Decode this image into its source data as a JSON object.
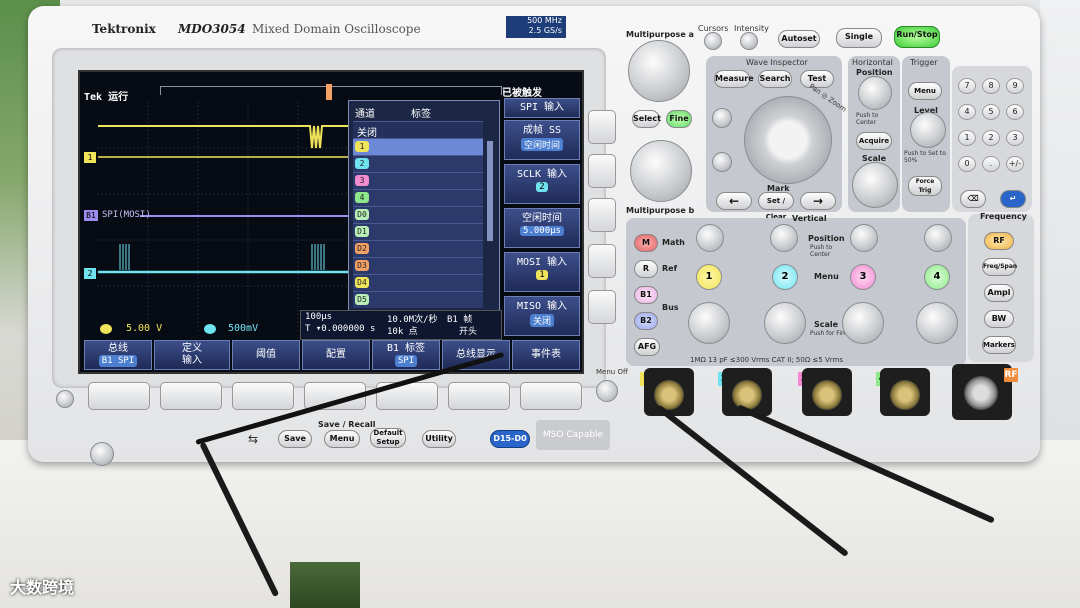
{
  "header": {
    "brand": "Tektronix",
    "model": "MDO3054",
    "subtitle": "Mixed Domain Oscilloscope",
    "spec_bw": "500 MHz",
    "spec_rate": "2.5 GS/s"
  },
  "screen": {
    "status_left": "Tek 运行",
    "status_right": "已被触发",
    "ch1_scale": "5.00 V",
    "ch2_scale": "500mV",
    "timebase": "100µs",
    "trigger_pos": "T ▾0.000000 s",
    "sample_rate": "10.0M次/秒",
    "record_length": "10k 点",
    "bus_trigger_label": "B1 帧",
    "bus_trigger_value": "开头",
    "bus_label": "SPI(MOSI)",
    "marker_1": "1",
    "marker_2": "2",
    "marker_b1": "B1",
    "channel_menu": {
      "col_channel": "通道",
      "col_label": "标签",
      "header_row": "关闭",
      "items": [
        {
          "label": "1",
          "color": "#f0e45a"
        },
        {
          "label": "2",
          "color": "#6fe3ef"
        },
        {
          "label": "3",
          "color": "#f28bd0"
        },
        {
          "label": "4",
          "color": "#8ee78a"
        },
        {
          "label": "D0",
          "color": "#b8f0b8"
        },
        {
          "label": "D1",
          "color": "#b8f0b8"
        },
        {
          "label": "D2",
          "color": "#f2a064"
        },
        {
          "label": "D3",
          "color": "#f2a064"
        },
        {
          "label": "D4",
          "color": "#f0e45a"
        },
        {
          "label": "D5",
          "color": "#b8f0b8"
        }
      ]
    },
    "right_panel": [
      {
        "title": "SPI 输入",
        "value": ""
      },
      {
        "title": "成帧 SS",
        "value": "空闲时间"
      },
      {
        "title": "SCLK 输入",
        "value": "2"
      },
      {
        "title": "空闲时间",
        "value": "5.000µs"
      },
      {
        "title": "MOSI 输入",
        "value": "1"
      },
      {
        "title": "MISO 输入",
        "value": "关闭"
      }
    ],
    "bottom_menu": [
      {
        "title": "总线",
        "sub": "B1 SPI"
      },
      {
        "title": "定义 输入",
        "sub": ""
      },
      {
        "title": "阈值",
        "sub": ""
      },
      {
        "title": "配置",
        "sub": ""
      },
      {
        "title": "B1 标签",
        "sub": "SPI"
      },
      {
        "title": "总线显示",
        "sub": ""
      },
      {
        "title": "事件表",
        "sub": ""
      }
    ],
    "colors": {
      "ch1": "#f0e45a",
      "ch2": "#6fe3ef",
      "bus": "#9c8cf0",
      "trigger": "#f2a064"
    }
  },
  "controls": {
    "multipurpose_a": "Multipurpose a",
    "multipurpose_b": "Multipurpose b",
    "cursors": "Cursors",
    "intensity": "Intensity",
    "autoset": "Autoset",
    "single": "Single",
    "run_stop": "Run/Stop",
    "select": "Select",
    "fine": "Fine",
    "wave_inspector": "Wave Inspector",
    "measure": "Measure",
    "search": "Search",
    "test": "Test",
    "pan_zoom": "Pan ◎ Zoom",
    "mark": "Mark",
    "set_clear": "Set / Clear",
    "horizontal": "Horizontal",
    "position": "Position",
    "push_to_center": "Push to Center",
    "acquire": "Acquire",
    "scale": "Scale",
    "trigger": "Trigger",
    "menu": "Menu",
    "level": "Level",
    "push_set_50": "Push to Set to 50%",
    "force_trig": "Force Trig",
    "vertical": "Vertical",
    "math": "Math",
    "ref": "Ref",
    "bus": "Bus",
    "b1": "B1",
    "b2": "B2",
    "afg": "AFG",
    "vert_position": "Position",
    "vert_push_center": "Push to Center",
    "vert_menu": "Menu",
    "vert_scale": "Scale",
    "push_for_fine": "Push for Fine",
    "ch_labels": [
      "1",
      "2",
      "3",
      "4"
    ],
    "ch_colors": [
      "#f0e45a",
      "#6fe3ef",
      "#f28bd0",
      "#8ee78a"
    ],
    "frequency": "Frequency",
    "rf": "RF",
    "freq_span": "Freq/Span",
    "ampl": "Ampl",
    "bw": "BW",
    "markers": "Markers",
    "save_recall": "Save / Recall",
    "save": "Save",
    "sr_menu": "Menu",
    "default_setup": "Default Setup",
    "utility": "Utility",
    "d15_d0": "D15-D0",
    "mso_capable": "MSO Capable",
    "menu_off": "Menu Off",
    "input_spec": "1MΩ 13 pF ≤300 Vrms CAT II; 50Ω ≤5 Vrms",
    "keypad": [
      "7",
      "8",
      "9",
      "4",
      "5",
      "6",
      "1",
      "2",
      "3",
      "0",
      ".",
      "+/-"
    ],
    "rf_tag": "RF",
    "usb": "⇆"
  },
  "watermark": "大数跨境"
}
